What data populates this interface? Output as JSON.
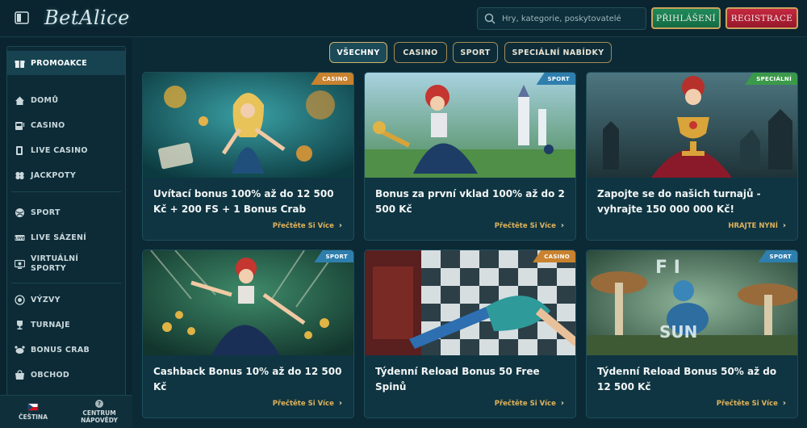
{
  "header": {
    "logo": "BetAlice",
    "search_placeholder": "Hry, kategorie, poskytovatelé",
    "login_label": "PŘIHLÁŠENÍ",
    "register_label": "REGISTRACE"
  },
  "sidebar": {
    "items": [
      {
        "label": "PROMOAKCE",
        "icon": "gift-icon"
      },
      {
        "label": "DOMŮ",
        "icon": "home-icon"
      },
      {
        "label": "CASINO",
        "icon": "slot-machine-icon"
      },
      {
        "label": "LIVE CASINO",
        "icon": "cards-icon"
      },
      {
        "label": "JACKPOTY",
        "icon": "clover-icon"
      },
      {
        "label": "SPORT",
        "icon": "ball-icon"
      },
      {
        "label": "LIVE SÁZENÍ",
        "icon": "live-icon"
      },
      {
        "label": "VIRTUÁLNÍ SPORTY",
        "icon": "virtual-sports-icon"
      },
      {
        "label": "VÝZVY",
        "icon": "target-icon"
      },
      {
        "label": "TURNAJE",
        "icon": "trophy-icon"
      },
      {
        "label": "BONUS CRAB",
        "icon": "crab-icon"
      },
      {
        "label": "OBCHOD",
        "icon": "shop-icon"
      }
    ],
    "footer": {
      "language": "ČEŠTINA",
      "help": "CENTRUM NÁPOVĚDY"
    }
  },
  "tabs": [
    {
      "label": "VŠECHNY",
      "active": true
    },
    {
      "label": "CASINO",
      "active": false
    },
    {
      "label": "SPORT",
      "active": false
    },
    {
      "label": "SPECIÁLNÍ NABÍDKY",
      "active": false
    }
  ],
  "cards": [
    {
      "badge": "CASINO",
      "badge_color": "#c9822f",
      "title": "Uvítací bonus 100% až do 12 500 Kč + 200 FS + 1 Bonus Crab",
      "link": "Přečtěte Si Více"
    },
    {
      "badge": "SPORT",
      "badge_color": "#2f7fae",
      "title": "Bonus za první vklad 100% až do 2 500 Kč",
      "link": "Přečtěte Si Více"
    },
    {
      "badge": "SPECIÁLNÍ",
      "badge_color": "#3b9a4a",
      "title": "Zapojte se do našich turnajů - vyhrajte 150 000 000 Kč!",
      "link": "HRAJTE NYNÍ"
    },
    {
      "badge": "SPORT",
      "badge_color": "#2f7fae",
      "title": "Cashback Bonus 10% až do 12 500 Kč",
      "link": "Přečtěte Si Více"
    },
    {
      "badge": "CASINO",
      "badge_color": "#c9822f",
      "title": "Týdenní Reload Bonus 50 Free Spinů",
      "link": "Přečtěte Si Více"
    },
    {
      "badge": "SPORT",
      "badge_color": "#2f7fae",
      "title": "Týdenní Reload Bonus 50% až do 12 500 Kč",
      "link": "Přečtěte Si Více"
    }
  ]
}
